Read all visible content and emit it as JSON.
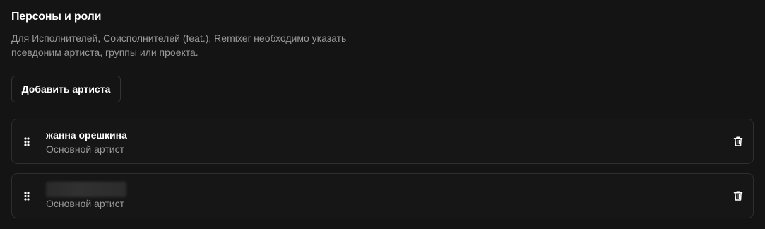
{
  "section": {
    "title": "Персоны и роли",
    "description_line1": "Для Исполнителей, Соисполнителей (feat.), Remixer необходимо указать",
    "description_line2": "псевдоним артиста, группы или проекта."
  },
  "add_artist_button": {
    "label": "Добавить артиста"
  },
  "artists": [
    {
      "name": "жанна орешкина",
      "role": "Основной артист",
      "name_hidden": false
    },
    {
      "name": "",
      "role": "Основной артист",
      "name_hidden": true
    }
  ],
  "icons": {
    "drag": "drag-handle-icon",
    "delete": "trash-icon"
  },
  "colors": {
    "background": "#141414",
    "text_primary": "#ffffff",
    "text_secondary": "#9a9a9a",
    "border": "#2e2e2e"
  }
}
